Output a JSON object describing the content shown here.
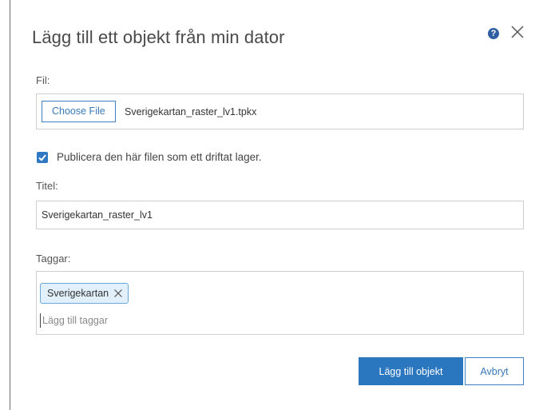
{
  "dialog": {
    "title": "Lägg till ett objekt från min dator",
    "help_glyph": "?",
    "help_icon": "help-icon",
    "close_icon": "close-icon"
  },
  "file": {
    "label": "Fil:",
    "choose_label": "Choose File",
    "file_name": "Sverigekartan_raster_lv1.tpkx"
  },
  "publish": {
    "checked": true,
    "label": "Publicera den här filen som ett driftat lager."
  },
  "title_field": {
    "label": "Titel:",
    "value": "Sverigekartan_raster_lv1"
  },
  "tags": {
    "label": "Taggar:",
    "items": [
      {
        "label": "Sverigekartan"
      }
    ],
    "placeholder": "Lägg till taggar"
  },
  "actions": {
    "add_label": "Lägg till objekt",
    "cancel_label": "Avbryt"
  },
  "colors": {
    "accent": "#2a76bf",
    "help_icon": "#2f5fa3",
    "tag_background": "#e2f0fb"
  }
}
